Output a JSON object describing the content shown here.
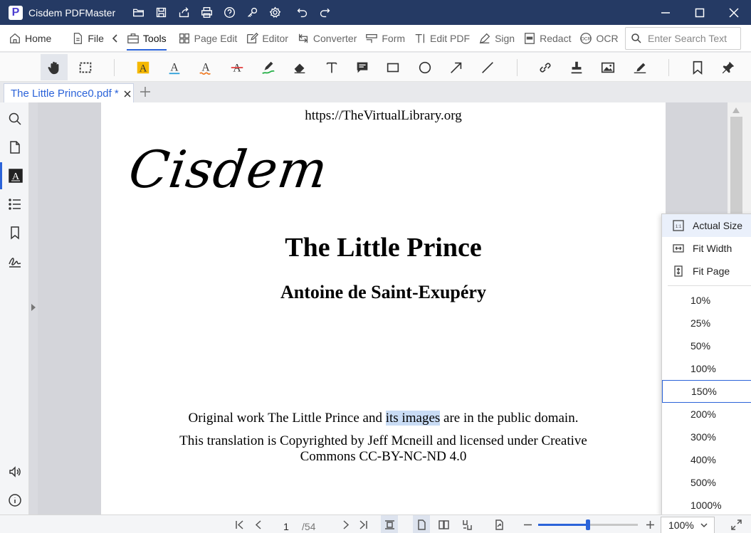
{
  "titlebar": {
    "app_title": "Cisdem PDFMaster",
    "logo_letter": "P",
    "icons": [
      "open-folder-icon",
      "save-icon",
      "share-icon",
      "print-icon",
      "help-icon",
      "key-icon",
      "settings-icon",
      "undo-icon",
      "redo-icon"
    ],
    "window_controls": [
      "minimize-icon",
      "maximize-icon",
      "close-icon"
    ]
  },
  "menubar": {
    "items": [
      {
        "label": "Home",
        "icon": "home-icon"
      },
      {
        "label": "File",
        "icon": "file-icon"
      },
      {
        "label": "Tools",
        "icon": "toolbox-icon",
        "active": true
      },
      {
        "label": "Page Edit",
        "icon": "grid-icon"
      },
      {
        "label": "Editor",
        "icon": "edit-icon"
      },
      {
        "label": "Converter",
        "icon": "convert-icon"
      },
      {
        "label": "Form",
        "icon": "form-icon"
      },
      {
        "label": "Edit PDF",
        "icon": "text-edit-icon"
      },
      {
        "label": "Sign",
        "icon": "sign-pen-icon"
      },
      {
        "label": "Redact",
        "icon": "redact-icon"
      },
      {
        "label": "OCR",
        "icon": "ocr-icon"
      }
    ],
    "search_placeholder": "Enter Search Text"
  },
  "toolbar": {
    "tools": [
      "hand-tool-icon",
      "marquee-select-icon",
      "highlight-text-icon",
      "underline-text-icon",
      "squiggly-text-icon",
      "strikeout-text-icon",
      "pen-draw-icon",
      "eraser-icon",
      "text-box-icon",
      "comment-note-icon",
      "rectangle-icon",
      "ellipse-icon",
      "arrow-icon",
      "line-icon",
      "link-icon",
      "stamp-icon",
      "image-icon",
      "signature-icon",
      "bookmark-icon",
      "pin-icon"
    ],
    "accent_yellow": "#f5b800",
    "accent_blue": "#2b63d9",
    "accent_orange": "#f07a22",
    "accent_red": "#e23b3b",
    "accent_green": "#2bb24c"
  },
  "tabs": [
    {
      "label": "The Little Prince0.pdf *"
    }
  ],
  "sidebar": {
    "icons": [
      "search-icon",
      "page-thumbnail-icon",
      "annotation-icon",
      "outline-list-icon",
      "bookmark-icon",
      "signature-icon",
      "read-aloud-icon",
      "info-icon"
    ]
  },
  "document": {
    "url": "https://TheVirtualLibrary.org",
    "logo_text": "Cisdem",
    "title": "The Little Prince",
    "author": "Antoine de Saint-Exupéry",
    "para1_before": "Original work The Little Prince and ",
    "para1_highlight": "its images",
    "para1_after": " are in the public domain.",
    "para2_line1": "This translation is Copyrighted by Jeff Mcneill and licensed under Creative",
    "para2_line2": "Commons CC-BY-NC-ND 4.0"
  },
  "zoom_menu": {
    "fit_options": [
      {
        "label": "Actual Size",
        "icon": "actual-size-icon"
      },
      {
        "label": "Fit Width",
        "icon": "fit-width-icon"
      },
      {
        "label": "Fit Page",
        "icon": "fit-page-icon"
      }
    ],
    "percent_options": [
      "10%",
      "25%",
      "50%",
      "100%",
      "150%",
      "200%",
      "300%",
      "400%",
      "500%",
      "1000%"
    ],
    "current": "150%"
  },
  "statusbar": {
    "current_page": "1",
    "total_pages": "/54",
    "zoom_value": "100%",
    "zoom_level_fraction": 0.5
  }
}
